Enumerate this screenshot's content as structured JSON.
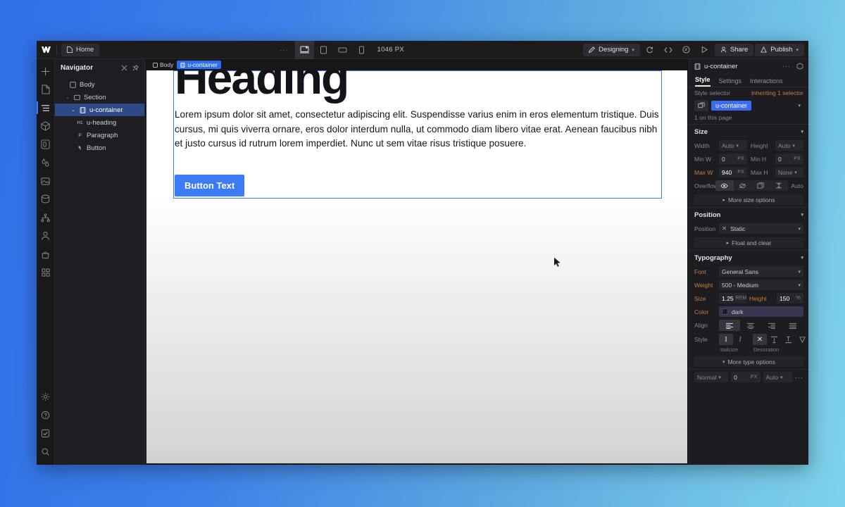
{
  "topbar": {
    "logo": "W",
    "page_tab": "Home",
    "overflow_dots": "···",
    "devices": [
      {
        "name": "desktop",
        "active": true
      },
      {
        "name": "tablet",
        "active": false
      },
      {
        "name": "mobile-landscape",
        "active": false
      },
      {
        "name": "mobile-portrait",
        "active": false
      }
    ],
    "viewport_width": "1046 PX",
    "mode_label": "Designing",
    "icons": [
      "refresh-icon",
      "code-icon",
      "comment-icon",
      "preview-icon"
    ],
    "share_label": "Share",
    "publish_label": "Publish"
  },
  "left_rail": {
    "items": [
      {
        "name": "add-panel",
        "icon": "plus-icon",
        "active": false
      },
      {
        "name": "pages-panel",
        "icon": "page-icon",
        "active": false
      },
      {
        "name": "navigator-panel",
        "icon": "navigator-icon",
        "active": true
      },
      {
        "name": "components-panel",
        "icon": "cube-icon",
        "active": false
      },
      {
        "name": "style-manager-panel",
        "icon": "style-icon",
        "active": false
      },
      {
        "name": "variables-panel",
        "icon": "droplets-icon",
        "active": false
      },
      {
        "name": "assets-panel",
        "icon": "image-icon",
        "active": false
      },
      {
        "name": "cms-panel",
        "icon": "database-icon",
        "active": false
      },
      {
        "name": "logic-panel",
        "icon": "sitemap-icon",
        "active": false
      },
      {
        "name": "users-panel",
        "icon": "user-icon",
        "active": false
      },
      {
        "name": "ecommerce-panel",
        "icon": "basket-icon",
        "active": false
      },
      {
        "name": "apps-panel",
        "icon": "grid-icon",
        "active": false
      }
    ],
    "bottom_items": [
      {
        "name": "settings",
        "icon": "gear-icon"
      },
      {
        "name": "help",
        "icon": "question-icon"
      },
      {
        "name": "audit",
        "icon": "check-icon"
      },
      {
        "name": "search",
        "icon": "search-icon"
      }
    ]
  },
  "navigator": {
    "title": "Navigator",
    "head_icons": [
      "collapse-all-icon",
      "pin-icon"
    ],
    "tree": [
      {
        "label": "Body",
        "tag": "",
        "icon": "body-icon",
        "depth": 0,
        "arrow": "",
        "selected": false
      },
      {
        "label": "Section",
        "tag": "",
        "icon": "section-icon",
        "depth": 1,
        "arrow": "⌄",
        "selected": false
      },
      {
        "label": "u-container",
        "tag": "",
        "icon": "container-icon",
        "depth": 2,
        "arrow": "⌄",
        "selected": true
      },
      {
        "label": "u-heading",
        "tag": "H1",
        "icon": "",
        "depth": 3,
        "arrow": "",
        "selected": false
      },
      {
        "label": "Paragraph",
        "tag": "P",
        "icon": "",
        "depth": 3,
        "arrow": "",
        "selected": false
      },
      {
        "label": "Button",
        "tag": "",
        "icon": "button-icon",
        "depth": 3,
        "arrow": "",
        "selected": false
      }
    ]
  },
  "breadcrumb": {
    "items": [
      {
        "label": "Body",
        "active": false
      },
      {
        "label": "u-container",
        "active": true
      }
    ]
  },
  "canvas": {
    "heading": "Heading",
    "paragraph": "Lorem ipsum dolor sit amet, consectetur adipiscing elit. Suspendisse varius enim in eros elementum tristique. Duis cursus, mi quis viverra ornare, eros dolor interdum nulla, ut commodo diam libero vitae erat. Aenean faucibus nibh et justo cursus id rutrum lorem imperdiet. Nunc ut sem vitae risus tristique posuere.",
    "button_label": "Button Text"
  },
  "right_panel": {
    "element_name": "u-container",
    "tabs": [
      {
        "label": "Style",
        "active": true
      },
      {
        "label": "Settings",
        "active": false
      },
      {
        "label": "Interactions",
        "active": false
      }
    ],
    "style_selector_label": "Style selector",
    "inheriting_text": "Inheriting 1 selector",
    "selector_chip": "u-container",
    "usage_note": "1 on this page",
    "size": {
      "title": "Size",
      "width_label": "Width",
      "width_value": "Auto",
      "height_label": "Height",
      "height_value": "Auto",
      "min_w_label": "Min W",
      "min_w_value": "0",
      "min_w_unit": "PX",
      "min_h_label": "Min H",
      "min_h_value": "0",
      "min_h_unit": "PX",
      "max_w_label": "Max W",
      "max_w_value": "940",
      "max_w_unit": "PX",
      "max_h_label": "Max H",
      "max_h_value": "None",
      "overflow_label": "Overflow",
      "overflow_options": [
        "visible-eye-icon",
        "hidden-eye-icon",
        "scroll-icon",
        "auto-icon"
      ],
      "overflow_auto_label": "Auto",
      "more_label": "More size options"
    },
    "position": {
      "title": "Position",
      "position_label": "Position",
      "position_value": "Static",
      "float_label": "Float and clear"
    },
    "typography": {
      "title": "Typography",
      "font_label": "Font",
      "font_value": "General Sans",
      "weight_label": "Weight",
      "weight_value": "500 - Medium",
      "size_label": "Size",
      "size_value": "1.25",
      "size_unit": "REM",
      "height_label": "Height",
      "height_value": "150",
      "height_unit": "%",
      "color_label": "Color",
      "color_value": "dark",
      "color_swatch": "#1b1d2b",
      "align_label": "Align",
      "align_options": [
        "align-left-icon",
        "align-center-icon",
        "align-right-icon",
        "align-justify-icon"
      ],
      "style_label": "Style",
      "style_options": [
        "upright-icon",
        "italic-icon",
        "no-decoration-icon",
        "overline-icon",
        "underline-icon",
        "strikethrough-icon"
      ],
      "italicize_caption": "Italicize",
      "decoration_caption": "Decoration",
      "more_label": "More type options"
    },
    "footer": {
      "mode_value": "Normal",
      "offset_value": "0",
      "offset_unit": "PX",
      "auto_value": "Auto",
      "dots": "···"
    }
  },
  "colors": {
    "accent_blue": "#3b7cf6",
    "selector_chip": "#3b6df2",
    "orange_label": "#c97b3f",
    "panel_bg": "#1d1d21"
  }
}
